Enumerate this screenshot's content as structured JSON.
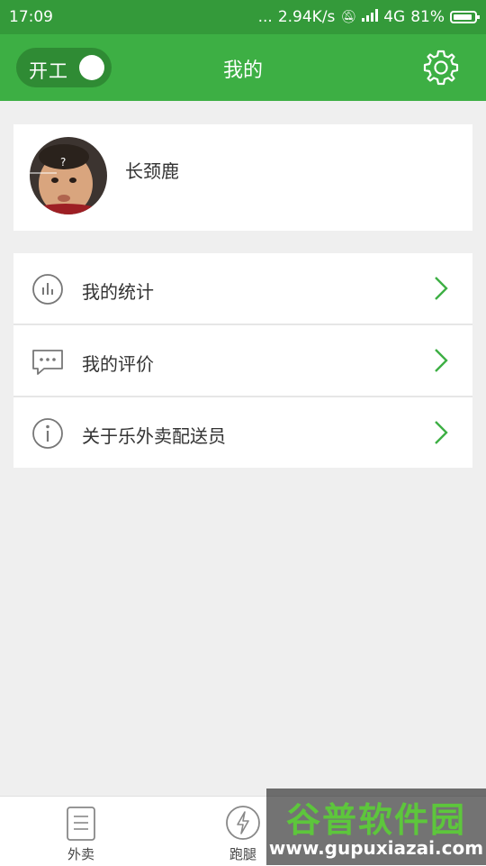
{
  "status_bar": {
    "time": "17:09",
    "dots": "...",
    "network_speed": "2.94K/s",
    "network_type": "4G",
    "battery_percent": "81%",
    "battery_level": 0.81
  },
  "header": {
    "toggle_label": "开工",
    "toggle_on": true,
    "title": "我的",
    "settings_icon": "gear-icon"
  },
  "profile": {
    "name": "长颈鹿",
    "avatar_mark": "?"
  },
  "menu": {
    "items": [
      {
        "label": "我的统计",
        "icon": "stats-icon"
      },
      {
        "label": "我的评价",
        "icon": "comment-icon"
      },
      {
        "label": "关于乐外卖配送员",
        "icon": "info-icon"
      }
    ]
  },
  "bottom_nav": {
    "items": [
      {
        "label": "外卖",
        "icon": "clipboard-icon"
      },
      {
        "label": "跑腿",
        "icon": "lightning-icon"
      }
    ]
  },
  "watermark": {
    "title": "谷普软件园",
    "url": "www.gupuxiazai.com"
  },
  "colors": {
    "status_bar": "#349a3a",
    "header": "#3daf44",
    "toggle_bg": "#2f8b34",
    "accent": "#3daf44",
    "page_bg": "#efefef"
  }
}
